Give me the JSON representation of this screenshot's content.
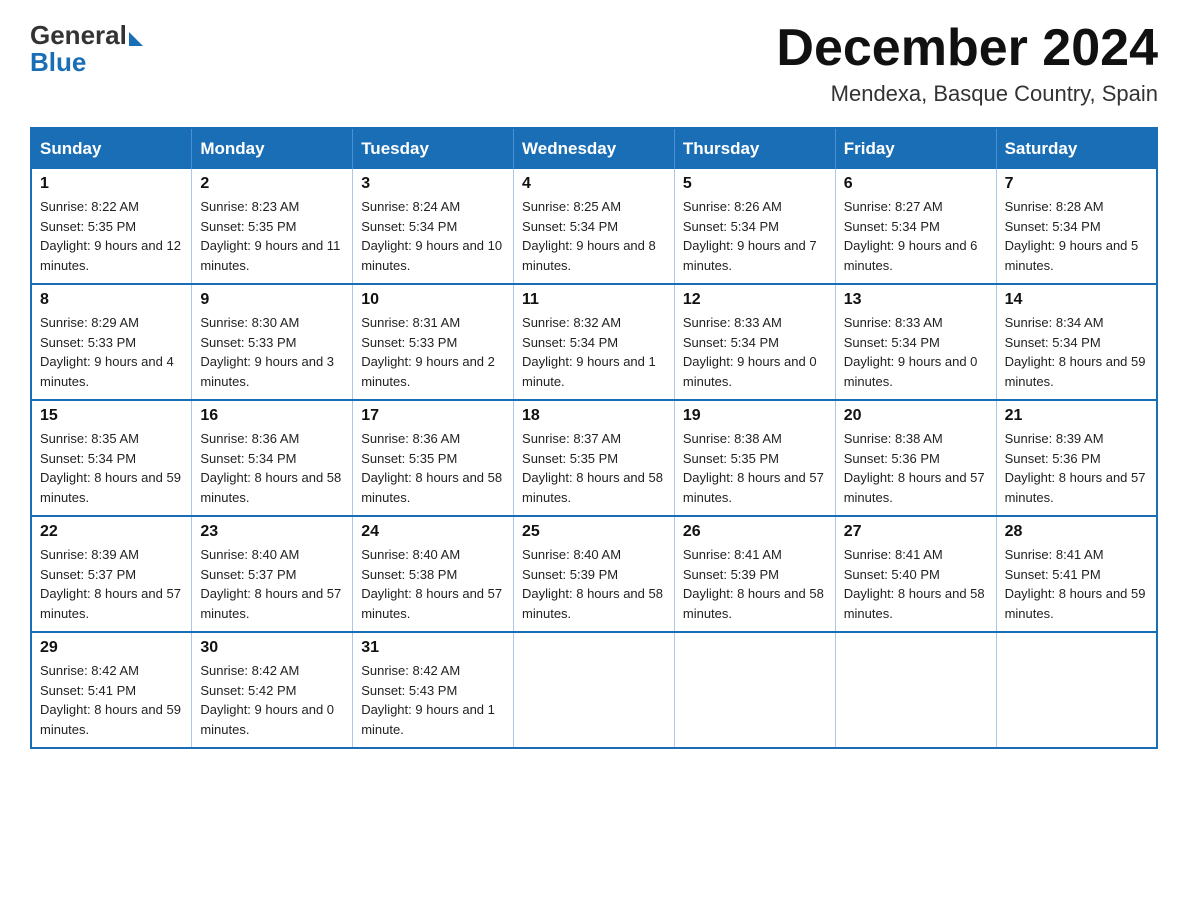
{
  "header": {
    "logo_general": "General",
    "logo_blue": "Blue",
    "month_title": "December 2024",
    "subtitle": "Mendexa, Basque Country, Spain"
  },
  "days_of_week": [
    "Sunday",
    "Monday",
    "Tuesday",
    "Wednesday",
    "Thursday",
    "Friday",
    "Saturday"
  ],
  "weeks": [
    [
      {
        "day": "1",
        "sunrise": "8:22 AM",
        "sunset": "5:35 PM",
        "daylight": "9 hours and 12 minutes."
      },
      {
        "day": "2",
        "sunrise": "8:23 AM",
        "sunset": "5:35 PM",
        "daylight": "9 hours and 11 minutes."
      },
      {
        "day": "3",
        "sunrise": "8:24 AM",
        "sunset": "5:34 PM",
        "daylight": "9 hours and 10 minutes."
      },
      {
        "day": "4",
        "sunrise": "8:25 AM",
        "sunset": "5:34 PM",
        "daylight": "9 hours and 8 minutes."
      },
      {
        "day": "5",
        "sunrise": "8:26 AM",
        "sunset": "5:34 PM",
        "daylight": "9 hours and 7 minutes."
      },
      {
        "day": "6",
        "sunrise": "8:27 AM",
        "sunset": "5:34 PM",
        "daylight": "9 hours and 6 minutes."
      },
      {
        "day": "7",
        "sunrise": "8:28 AM",
        "sunset": "5:34 PM",
        "daylight": "9 hours and 5 minutes."
      }
    ],
    [
      {
        "day": "8",
        "sunrise": "8:29 AM",
        "sunset": "5:33 PM",
        "daylight": "9 hours and 4 minutes."
      },
      {
        "day": "9",
        "sunrise": "8:30 AM",
        "sunset": "5:33 PM",
        "daylight": "9 hours and 3 minutes."
      },
      {
        "day": "10",
        "sunrise": "8:31 AM",
        "sunset": "5:33 PM",
        "daylight": "9 hours and 2 minutes."
      },
      {
        "day": "11",
        "sunrise": "8:32 AM",
        "sunset": "5:34 PM",
        "daylight": "9 hours and 1 minute."
      },
      {
        "day": "12",
        "sunrise": "8:33 AM",
        "sunset": "5:34 PM",
        "daylight": "9 hours and 0 minutes."
      },
      {
        "day": "13",
        "sunrise": "8:33 AM",
        "sunset": "5:34 PM",
        "daylight": "9 hours and 0 minutes."
      },
      {
        "day": "14",
        "sunrise": "8:34 AM",
        "sunset": "5:34 PM",
        "daylight": "8 hours and 59 minutes."
      }
    ],
    [
      {
        "day": "15",
        "sunrise": "8:35 AM",
        "sunset": "5:34 PM",
        "daylight": "8 hours and 59 minutes."
      },
      {
        "day": "16",
        "sunrise": "8:36 AM",
        "sunset": "5:34 PM",
        "daylight": "8 hours and 58 minutes."
      },
      {
        "day": "17",
        "sunrise": "8:36 AM",
        "sunset": "5:35 PM",
        "daylight": "8 hours and 58 minutes."
      },
      {
        "day": "18",
        "sunrise": "8:37 AM",
        "sunset": "5:35 PM",
        "daylight": "8 hours and 58 minutes."
      },
      {
        "day": "19",
        "sunrise": "8:38 AM",
        "sunset": "5:35 PM",
        "daylight": "8 hours and 57 minutes."
      },
      {
        "day": "20",
        "sunrise": "8:38 AM",
        "sunset": "5:36 PM",
        "daylight": "8 hours and 57 minutes."
      },
      {
        "day": "21",
        "sunrise": "8:39 AM",
        "sunset": "5:36 PM",
        "daylight": "8 hours and 57 minutes."
      }
    ],
    [
      {
        "day": "22",
        "sunrise": "8:39 AM",
        "sunset": "5:37 PM",
        "daylight": "8 hours and 57 minutes."
      },
      {
        "day": "23",
        "sunrise": "8:40 AM",
        "sunset": "5:37 PM",
        "daylight": "8 hours and 57 minutes."
      },
      {
        "day": "24",
        "sunrise": "8:40 AM",
        "sunset": "5:38 PM",
        "daylight": "8 hours and 57 minutes."
      },
      {
        "day": "25",
        "sunrise": "8:40 AM",
        "sunset": "5:39 PM",
        "daylight": "8 hours and 58 minutes."
      },
      {
        "day": "26",
        "sunrise": "8:41 AM",
        "sunset": "5:39 PM",
        "daylight": "8 hours and 58 minutes."
      },
      {
        "day": "27",
        "sunrise": "8:41 AM",
        "sunset": "5:40 PM",
        "daylight": "8 hours and 58 minutes."
      },
      {
        "day": "28",
        "sunrise": "8:41 AM",
        "sunset": "5:41 PM",
        "daylight": "8 hours and 59 minutes."
      }
    ],
    [
      {
        "day": "29",
        "sunrise": "8:42 AM",
        "sunset": "5:41 PM",
        "daylight": "8 hours and 59 minutes."
      },
      {
        "day": "30",
        "sunrise": "8:42 AM",
        "sunset": "5:42 PM",
        "daylight": "9 hours and 0 minutes."
      },
      {
        "day": "31",
        "sunrise": "8:42 AM",
        "sunset": "5:43 PM",
        "daylight": "9 hours and 1 minute."
      },
      null,
      null,
      null,
      null
    ]
  ],
  "labels": {
    "sunrise": "Sunrise:",
    "sunset": "Sunset:",
    "daylight": "Daylight:"
  }
}
